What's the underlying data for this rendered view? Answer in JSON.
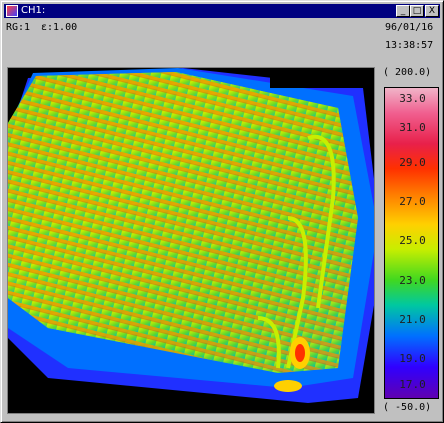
{
  "window": {
    "title": "CH1:"
  },
  "titlebar_buttons": {
    "minimize": "_",
    "maximize": "□",
    "close": "X"
  },
  "header": {
    "range": "RG:1",
    "emissivity": "ε:1.00",
    "date": "96/01/16",
    "time": "13:38:57"
  },
  "scale": {
    "max_label": "( 200.0)",
    "min_label": "( -50.0)",
    "ticks": [
      "33.0",
      "31.0",
      "29.0",
      "27.0",
      "25.0",
      "23.0",
      "21.0",
      "19.0",
      "17.0"
    ]
  },
  "colors": {
    "titlebar": "#000080",
    "window_face": "#c0c0c0",
    "hot": "#ff3000",
    "warm": "#c8ee00",
    "cool": "#00c8a0",
    "cold": "#3000ff"
  }
}
